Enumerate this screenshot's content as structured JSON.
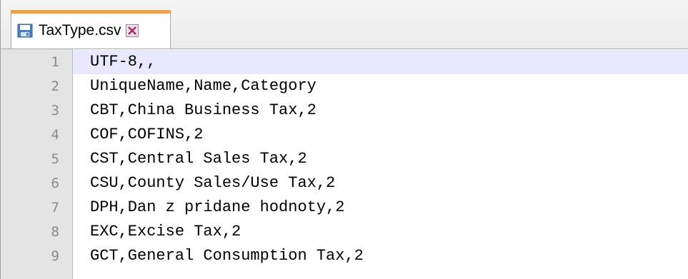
{
  "tab": {
    "label": "TaxType.csv",
    "icon": "save-icon",
    "close_icon": "close-icon",
    "accent_color": "#f3a23c"
  },
  "editor": {
    "current_line": 1,
    "current_line_color": "#e8e8ff",
    "lines": [
      {
        "number": "1",
        "text": "UTF-8,,"
      },
      {
        "number": "2",
        "text": "UniqueName,Name,Category"
      },
      {
        "number": "3",
        "text": "CBT,China Business Tax,2"
      },
      {
        "number": "4",
        "text": "COF,COFINS,2"
      },
      {
        "number": "5",
        "text": "CST,Central Sales Tax,2"
      },
      {
        "number": "6",
        "text": "CSU,County Sales/Use Tax,2"
      },
      {
        "number": "7",
        "text": "DPH,Dan z pridane hodnoty,2"
      },
      {
        "number": "8",
        "text": "EXC,Excise Tax,2"
      },
      {
        "number": "9",
        "text": "GCT,General Consumption Tax,2"
      }
    ]
  }
}
